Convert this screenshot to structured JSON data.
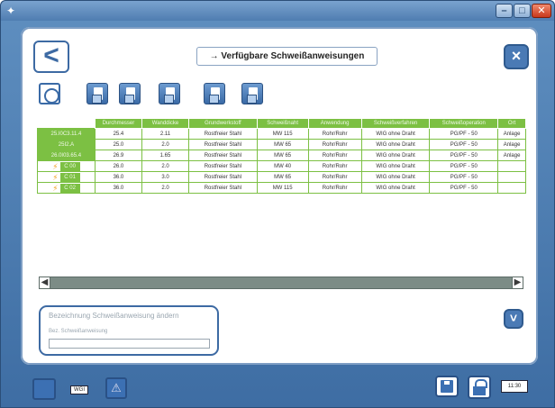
{
  "window": {
    "app_icon": "app-icon",
    "controls": {
      "minimize": "minimize-icon",
      "maximize": "maximize-icon",
      "close": "close-icon"
    }
  },
  "header": {
    "back_icon": "<",
    "title": "→ Verfügbare Schweißanweisungen",
    "close_icon": "×"
  },
  "toolbar": {
    "icons": [
      "refresh-icon",
      "new-document-icon",
      "copy-document-icon",
      "delete-document-icon",
      "export-document-icon",
      "import-document-icon"
    ]
  },
  "table": {
    "columns": [
      "Durchmesser",
      "Wanddicke",
      "Grundwerkstoff",
      "Schweißnaht",
      "Anwendung",
      "Schweißverfahren",
      "Schweißoperation",
      "Ort"
    ],
    "rows": [
      {
        "key": "25.I0C3.11.4",
        "icon": "",
        "cells": [
          "25.4",
          "2.11",
          "Rostfreier Stahl",
          "MW 115",
          "Rohr/Rohr",
          "WIG ohne Draht",
          "PG/PF - 50",
          "Anlage"
        ]
      },
      {
        "key": "25I2.A",
        "icon": "",
        "cells": [
          "25.0",
          "2.0",
          "Rostfreier Stahl",
          "MW 65",
          "Rohr/Rohr",
          "WIG ohne Draht",
          "PG/PF - 50",
          "Anlage"
        ]
      },
      {
        "key": "26.0I03.65.4",
        "icon": "",
        "cells": [
          "26.9",
          "1.65",
          "Rostfreier Stahl",
          "MW 65",
          "Rohr/Rohr",
          "WIG ohne Draht",
          "PG/PF - 50",
          "Anlage"
        ]
      },
      {
        "key": "C 00",
        "icon": "lightning-icon",
        "cells": [
          "26.0",
          "2.0",
          "Rostfreier Stahl",
          "MW 40",
          "Rohr/Rohr",
          "WIG ohne Draht",
          "PG/PF - 50",
          ""
        ]
      },
      {
        "key": "C 01",
        "icon": "lightning-icon",
        "cells": [
          "36.0",
          "3.0",
          "Rostfreier Stahl",
          "MW 65",
          "Rohr/Rohr",
          "WIG ohne Draht",
          "PG/PF - 50",
          ""
        ]
      },
      {
        "key": "C 02",
        "icon": "lightning-icon",
        "cells": [
          "36.0",
          "2.0",
          "Rostfreier Stahl",
          "MW 115",
          "Rohr/Rohr",
          "WIG ohne Draht",
          "PG/PF - 50",
          ""
        ]
      }
    ]
  },
  "scrollbar": {
    "left": "◀",
    "right": "▶"
  },
  "panel": {
    "title": "Bezeichnung Schweißanweisung ändern",
    "label": "Bez. Schweißanweisung",
    "input_value": ""
  },
  "down_button": "˅",
  "footer": {
    "label": "WGI",
    "time": "11:30",
    "warn_glyph": "⚠"
  },
  "colors": {
    "accent": "#3d6aa3",
    "green": "#7cc043",
    "frame": "#4f7db1"
  }
}
